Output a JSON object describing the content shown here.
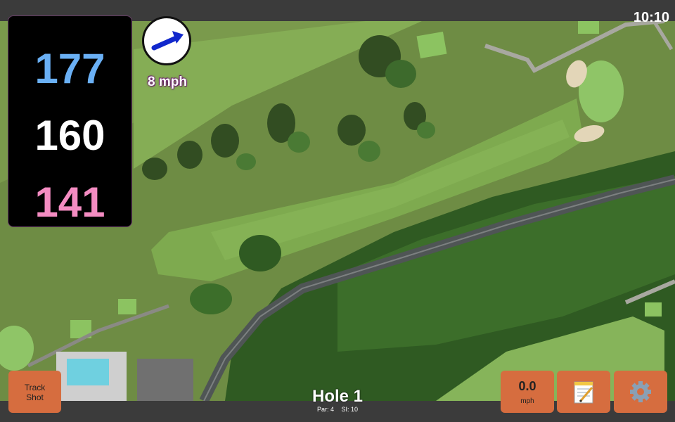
{
  "status": {
    "time": "10:10"
  },
  "distances": {
    "back": "177",
    "middle": "160",
    "front": "141"
  },
  "wind": {
    "speed": "8 mph"
  },
  "hole": {
    "title": "Hole 1",
    "par": "Par: 4",
    "si": "SI: 10"
  },
  "buttons": {
    "track_shot_line1": "Track",
    "track_shot_line2": "Shot",
    "speed_value": "0.0",
    "speed_unit": "mph"
  },
  "icons": {
    "wind": "wind-direction-arrow-icon",
    "notes": "notepad-icon",
    "settings": "gear-icon"
  },
  "colors": {
    "back": "#6ab0f5",
    "middle": "#ffffff",
    "front": "#f48cc2",
    "button": "#d66d3f"
  }
}
